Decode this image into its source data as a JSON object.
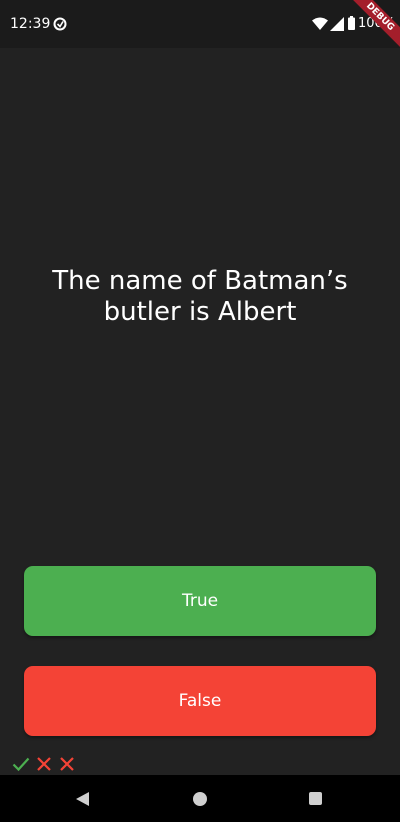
{
  "status_bar": {
    "time": "12:39",
    "battery": "100%",
    "icons": [
      "app-notification-icon",
      "wifi-icon",
      "signal-icon",
      "battery-icon"
    ]
  },
  "debug_banner": {
    "label": "DEBUG"
  },
  "quiz": {
    "question": "The name of Batman’s butler is Albert",
    "true_label": "True",
    "false_label": "False"
  },
  "score_keeper": {
    "marks": [
      {
        "icon": "check-icon",
        "color": "#4caf50"
      },
      {
        "icon": "close-icon",
        "color": "#f44336"
      },
      {
        "icon": "close-icon",
        "color": "#f44336"
      }
    ]
  },
  "nav_bar": {
    "icons": [
      "back-icon",
      "home-icon",
      "recents-icon"
    ]
  },
  "colors": {
    "background": "#222222",
    "true_button": "#4caf50",
    "false_button": "#f44336",
    "debug_ribbon": "#a41e2b"
  }
}
